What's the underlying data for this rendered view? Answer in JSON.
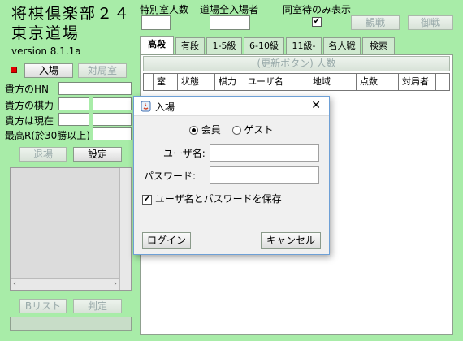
{
  "app": {
    "title_line1": "将棋倶楽部２４",
    "title_line2": "東京道場",
    "version": "version 8.1.1a"
  },
  "top": {
    "special_room_label": "特別室人数",
    "dojo_total_label": "道場全入場者",
    "same_room_only_label": "同室待のみ表示",
    "same_room_only_checked": "✔",
    "watch_button": "観戦",
    "opponent_button": "御戦"
  },
  "left": {
    "enter_button": "入場",
    "opponent_room_button": "対局室",
    "hn_label": "貴方のHN",
    "rating_label": "貴方の棋力",
    "current_label": "貴方は現在",
    "max_rating_label": "最高R(於30勝以上)",
    "leave_button": "退場",
    "settings_button": "設定",
    "blist_button": "Bリスト",
    "judge_button": "判定"
  },
  "tabs": [
    {
      "label": "高段",
      "active": true
    },
    {
      "label": "有段",
      "active": false
    },
    {
      "label": "1-5級",
      "active": false
    },
    {
      "label": "6-10級",
      "active": false
    },
    {
      "label": "11級-",
      "active": false
    },
    {
      "label": "名人戦",
      "active": false
    },
    {
      "label": "検索",
      "active": false
    }
  ],
  "table": {
    "banner": "(更新ボタン) 人数",
    "columns": [
      "室",
      "状態",
      "棋力",
      "ユーザ名",
      "地域",
      "点数",
      "対局者"
    ]
  },
  "dialog": {
    "title": "入場",
    "member_label": "会員",
    "guest_label": "ゲスト",
    "username_label": "ユーザ名:",
    "password_label": "パスワード:",
    "username_value": "",
    "password_value": "",
    "save_label": "ユーザ名とパスワードを保存",
    "save_checked": "✔",
    "login_button": "ログイン",
    "cancel_button": "キャンセル",
    "close_glyph": "✕"
  }
}
